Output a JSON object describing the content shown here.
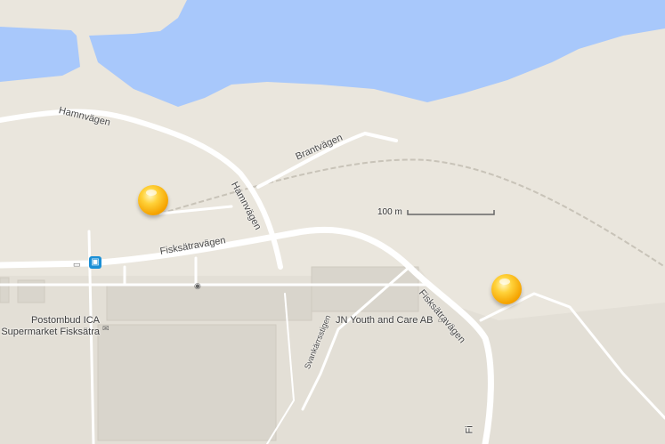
{
  "map": {
    "water_color": "#a8c8fb",
    "land_color": "#eae6dd",
    "road_color": "#ffffff",
    "building_color": "#d9d5cc",
    "rail_color": "#c8c3b8"
  },
  "streets": {
    "hamnvagen_1": "Hamnvägen",
    "hamnvagen_2": "Hamnvägen",
    "brantvagen": "Brantvägen",
    "fisksatravagen_1": "Fisksätravägen",
    "fisksatravagen_2": "Fisksätravägen",
    "fisksatravagen_3": "Fi",
    "svankarrsstigen": "Svankärrsstigen"
  },
  "places": {
    "postombud_line1": "Postombud ICA",
    "postombud_line2": "Supermarket Fisksätra",
    "jn_youth": "JN Youth and Care AB"
  },
  "scale": {
    "label": "100 m"
  },
  "icons": {
    "bus_stop": "bus-stop-icon",
    "mail": "mail-icon",
    "hotel": "hotel-icon",
    "marker": "map-marker-icon"
  }
}
